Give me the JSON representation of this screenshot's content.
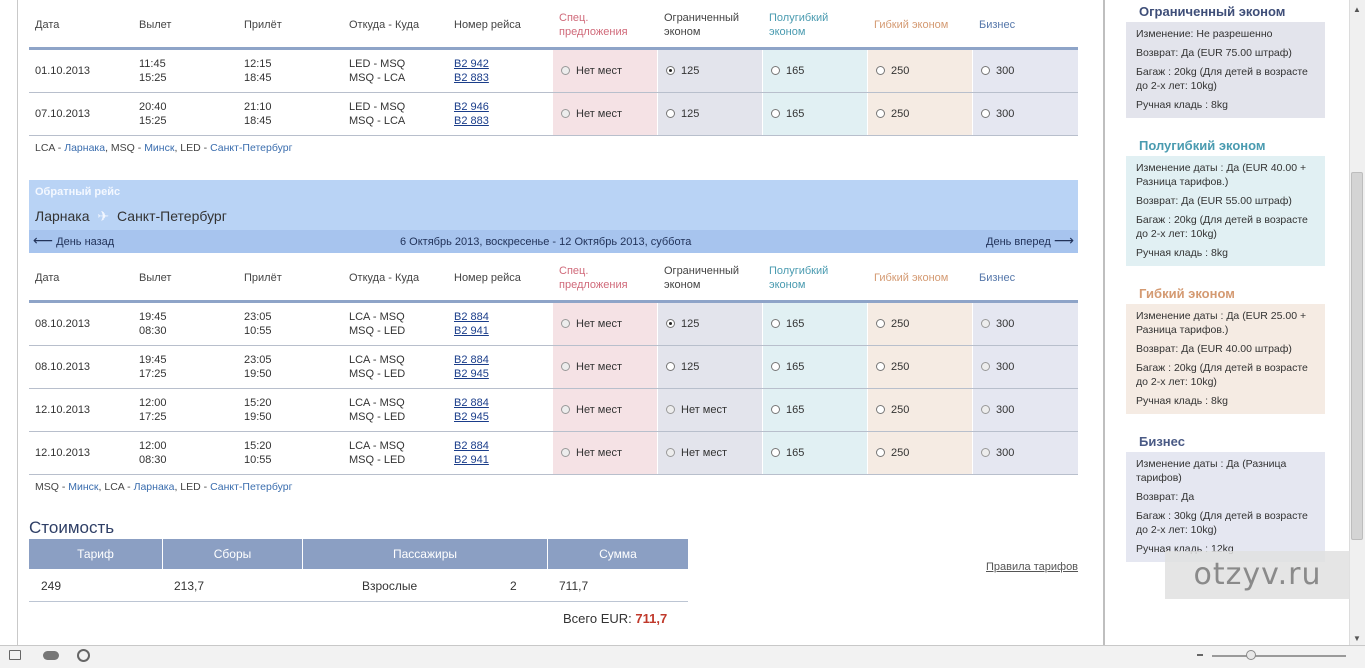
{
  "columns": {
    "date": "Дата",
    "depart": "Вылет",
    "arrive": "Прилёт",
    "route": "Откуда - Куда",
    "flight": "Номер рейса",
    "special_1": "Спец.",
    "special_2": "предложения",
    "limited_1": "Ограниченный",
    "limited_2": "эконом",
    "semi_1": "Полугибкий",
    "semi_2": "эконом",
    "flex": "Гибкий эконом",
    "biz": "Бизнес"
  },
  "outbound": {
    "rows": [
      {
        "date": "01.10.2013",
        "dep1": "11:45",
        "dep2": "15:25",
        "arr1": "12:15",
        "arr2": "18:45",
        "rt1": "LED - MSQ",
        "rt2": "MSQ - LCA",
        "fl1": "B2 942",
        "fl2": "B2 883",
        "special": "Нет мест",
        "limited": "125",
        "semi": "165",
        "flex": "250",
        "biz": "300"
      },
      {
        "date": "07.10.2013",
        "dep1": "20:40",
        "dep2": "15:25",
        "arr1": "21:10",
        "arr2": "18:45",
        "rt1": "LED - MSQ",
        "rt2": "MSQ - LCA",
        "fl1": "B2 946",
        "fl2": "B2 883",
        "special": "Нет мест",
        "limited": "125",
        "semi": "165",
        "flex": "250",
        "biz": "300"
      }
    ],
    "legend": {
      "c1": "LCA",
      "n1": "Ларнака",
      "c2": "MSQ",
      "n2": "Минск",
      "c3": "LED",
      "n3": "Санкт-Петербург"
    }
  },
  "return": {
    "label": "Обратный рейс",
    "from": "Ларнака",
    "to": "Санкт-Петербург",
    "plane_icon": "✈",
    "prev": "День назад",
    "next": "День вперед",
    "range": "6 Октябрь 2013, воскресенье - 12 Октябрь 2013, суббота",
    "rows": [
      {
        "date": "08.10.2013",
        "dep1": "19:45",
        "dep2": "08:30",
        "arr1": "23:05",
        "arr2": "10:55",
        "rt1": "LCA - MSQ",
        "rt2": "MSQ - LED",
        "fl1": "B2 884",
        "fl2": "B2 941",
        "special": "Нет мест",
        "limited": "125",
        "semi": "165",
        "flex": "250",
        "biz": "300"
      },
      {
        "date": "08.10.2013",
        "dep1": "19:45",
        "dep2": "17:25",
        "arr1": "23:05",
        "arr2": "19:50",
        "rt1": "LCA - MSQ",
        "rt2": "MSQ - LED",
        "fl1": "B2 884",
        "fl2": "B2 945",
        "special": "Нет мест",
        "limited": "125",
        "semi": "165",
        "flex": "250",
        "biz": "300"
      },
      {
        "date": "12.10.2013",
        "dep1": "12:00",
        "dep2": "17:25",
        "arr1": "15:20",
        "arr2": "19:50",
        "rt1": "LCA - MSQ",
        "rt2": "MSQ - LED",
        "fl1": "B2 884",
        "fl2": "B2 945",
        "special": "Нет мест",
        "limited": "Нет мест",
        "semi": "165",
        "flex": "250",
        "biz": "300"
      },
      {
        "date": "12.10.2013",
        "dep1": "12:00",
        "dep2": "08:30",
        "arr1": "15:20",
        "arr2": "10:55",
        "rt1": "LCA - MSQ",
        "rt2": "MSQ - LED",
        "fl1": "B2 884",
        "fl2": "B2 941",
        "special": "Нет мест",
        "limited": "Нет мест",
        "semi": "165",
        "flex": "250",
        "biz": "300"
      }
    ],
    "legend": {
      "c1": "MSQ",
      "n1": "Минск",
      "c2": "LCA",
      "n2": "Ларнака",
      "c3": "LED",
      "n3": "Санкт-Петербург"
    }
  },
  "cost": {
    "title": "Стоимость",
    "h_fare": "Тариф",
    "h_fees": "Сборы",
    "h_pax": "Пассажиры",
    "h_sum": "Сумма",
    "fare": "249",
    "fees": "213,7",
    "pax_type": "Взрослые",
    "pax_count": "2",
    "sum": "711,7",
    "total_label": "Всего EUR:",
    "total_value": "711,7",
    "rules_link": "Правила тарифов"
  },
  "sidebar": {
    "limited": {
      "title": "Ограниченный эконом",
      "l1": "Изменение: Не разрешенно",
      "l2": "Возврат: Да (EUR 75.00 штраф)",
      "l3": "Багаж : 20kg (Для детей в возрасте до 2-х лет: 10kg)",
      "l4": "Ручная кладь : 8kg"
    },
    "semi": {
      "title": "Полугибкий эконом",
      "l1": "Изменение даты : Да (EUR 40.00 + Разница тарифов.)",
      "l2": "Возврат: Да (EUR 55.00 штраф)",
      "l3": "Багаж : 20kg (Для детей в возрасте до 2-х лет: 10kg)",
      "l4": "Ручная кладь : 8kg"
    },
    "flex": {
      "title": "Гибкий эконом",
      "l1": "Изменение даты : Да (EUR 25.00 + Разница тарифов.)",
      "l2": "Возврат: Да (EUR 40.00 штраф)",
      "l3": "Багаж : 20kg (Для детей в возрасте до 2-х лет: 10kg)",
      "l4": "Ручная кладь : 8kg"
    },
    "biz": {
      "title": "Бизнес",
      "l1": "Изменение даты : Да (Разница тарифов)",
      "l2": "Возврат: Да",
      "l3": "Багаж : 30kg (Для детей в возрасте до 2-х лет: 10kg)",
      "l4": "Ручная кладь : 12kg"
    }
  },
  "watermark": "otzyv.ru",
  "colors": {
    "header_blue": "#8b9fc3",
    "return_band": "#b9d3f5",
    "total_red": "#c0392b"
  }
}
